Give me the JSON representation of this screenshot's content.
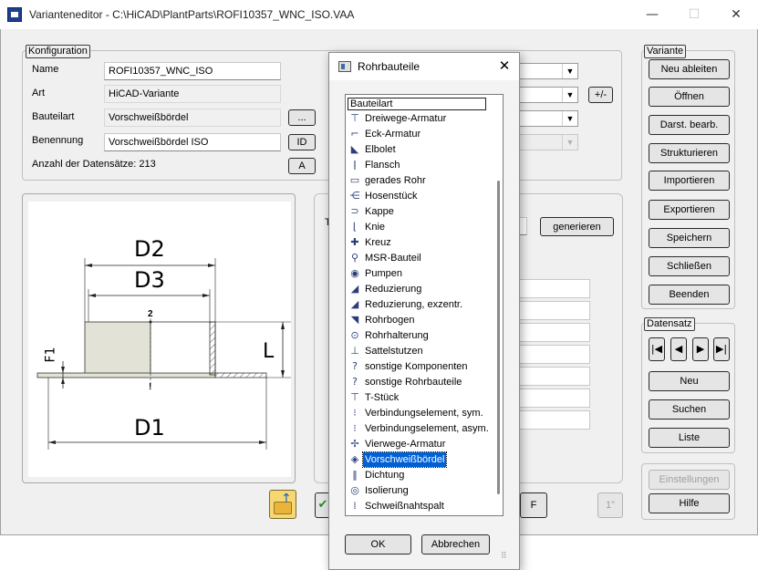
{
  "window": {
    "title": "Varianteneditor - C:\\HiCAD\\PlantParts\\ROFI10357_WNC_ISO.VAA",
    "minimize": "—",
    "maximize": "☐",
    "close": "✕"
  },
  "konfiguration": {
    "legend": "Konfiguration",
    "name_label": "Name",
    "name_value": "ROFI10357_WNC_ISO",
    "art_label": "Art",
    "art_value": "HiCAD-Variante",
    "bauteilart_label": "Bauteilart",
    "bauteilart_value": "Vorschweißbördel",
    "bauteilart_button": "...",
    "benennung_label": "Benennung",
    "benennung_value": "Vorschweißbördel ISO",
    "benennung_button": "ID",
    "count_label": "Anzahl der Datensätze: 213",
    "count_button": "A",
    "plusminus_button": "+/-"
  },
  "middle": {
    "t_label": "T",
    "generate_button": "generieren"
  },
  "drawing": {
    "d2": "D2",
    "d3": "D3",
    "d1": "D1",
    "f1": "F1",
    "l": "L",
    "point2": "2",
    "point1": "!"
  },
  "variante": {
    "legend": "Variante",
    "buttons": [
      "Neu ableiten",
      "Öffnen",
      "Darst. bearb.",
      "Strukturieren",
      "Importieren",
      "Exportieren",
      "Speichern",
      "Schließen",
      "Beenden"
    ]
  },
  "datensatz": {
    "legend": "Datensatz",
    "nav": [
      "|◀",
      "◀",
      "▶",
      "▶|"
    ],
    "buttons": [
      "Neu",
      "Suchen",
      "Liste"
    ]
  },
  "settings": {
    "einstellungen": "Einstellungen",
    "hilfe": "Hilfe"
  },
  "bottom_bar": {
    "f_button": "F",
    "one_button": "1\""
  },
  "dialog": {
    "title": "Rohrbauteile",
    "close": "✕",
    "header": "Bauteilart",
    "items": [
      {
        "label": "Dreiwege-Armatur",
        "icon": "valve-3way-icon",
        "glyph": "⊤"
      },
      {
        "label": "Eck-Armatur",
        "icon": "angle-valve-icon",
        "glyph": "⌐"
      },
      {
        "label": "Elbolet",
        "icon": "elbolet-icon",
        "glyph": "◣"
      },
      {
        "label": "Flansch",
        "icon": "flange-icon",
        "glyph": "ǀ"
      },
      {
        "label": "gerades Rohr",
        "icon": "pipe-icon",
        "glyph": "▭"
      },
      {
        "label": "Hosenstück",
        "icon": "y-piece-icon",
        "glyph": "⋲"
      },
      {
        "label": "Kappe",
        "icon": "cap-icon",
        "glyph": "⊃"
      },
      {
        "label": "Knie",
        "icon": "elbow-icon",
        "glyph": "⌊"
      },
      {
        "label": "Kreuz",
        "icon": "cross-icon",
        "glyph": "✚"
      },
      {
        "label": "MSR-Bauteil",
        "icon": "measurement-icon",
        "glyph": "⚲"
      },
      {
        "label": "Pumpen",
        "icon": "pump-icon",
        "glyph": "◉"
      },
      {
        "label": "Reduzierung",
        "icon": "reducer-icon",
        "glyph": "◢"
      },
      {
        "label": "Reduzierung, exzentr.",
        "icon": "eccentric-reducer-icon",
        "glyph": "◢"
      },
      {
        "label": "Rohrbogen",
        "icon": "pipe-bend-icon",
        "glyph": "◥"
      },
      {
        "label": "Rohrhalterung",
        "icon": "pipe-support-icon",
        "glyph": "⊙"
      },
      {
        "label": "Sattelstutzen",
        "icon": "saddle-icon",
        "glyph": "⊥"
      },
      {
        "label": "sonstige Komponenten",
        "icon": "unknown-icon",
        "glyph": "?"
      },
      {
        "label": "sonstige Rohrbauteile",
        "icon": "unknown-icon",
        "glyph": "?"
      },
      {
        "label": "T-Stück",
        "icon": "tee-icon",
        "glyph": "⊤"
      },
      {
        "label": "Verbindungselement, sym.",
        "icon": "connector-sym-icon",
        "glyph": "⁝"
      },
      {
        "label": "Verbindungselement, asym.",
        "icon": "connector-asym-icon",
        "glyph": "⁝"
      },
      {
        "label": "Vierwege-Armatur",
        "icon": "valve-4way-icon",
        "glyph": "✢"
      },
      {
        "label": "Vorschweißbördel",
        "icon": "weld-collar-icon",
        "glyph": "◈"
      },
      {
        "label": "Dichtung",
        "icon": "gasket-icon",
        "glyph": "‖"
      },
      {
        "label": "Isolierung",
        "icon": "insulation-icon",
        "glyph": "◎"
      },
      {
        "label": "Schweißnahtspalt",
        "icon": "weld-gap-icon",
        "glyph": "⁞"
      }
    ],
    "selected_index": 22,
    "ok": "OK",
    "cancel": "Abbrechen"
  }
}
